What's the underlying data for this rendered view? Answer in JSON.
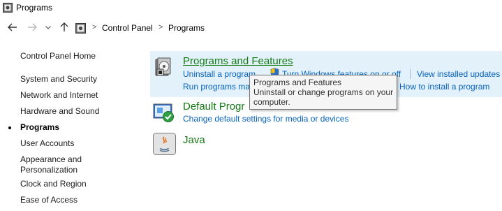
{
  "window": {
    "title": "Programs"
  },
  "breadcrumb": {
    "items": [
      "Control Panel",
      "Programs"
    ],
    "separator": ">"
  },
  "sidebar": {
    "home": "Control Panel Home",
    "items": [
      "System and Security",
      "Network and Internet",
      "Hardware and Sound",
      "Programs",
      "User Accounts",
      "Appearance and Personalization",
      "Clock and Region",
      "Ease of Access"
    ],
    "current": "Programs",
    "appearance_line1": "Appearance and",
    "appearance_line2": "Personalization"
  },
  "categories": {
    "programs_features": {
      "title": "Programs and Features",
      "links": [
        "Uninstall a program",
        "Turn Windows features on or off",
        "View installed updates"
      ],
      "run_older": "Run programs ma",
      "how_to_install": "How to install a program"
    },
    "default_programs": {
      "title": "Default Progr",
      "link": "Change default settings for media or devices"
    },
    "java": {
      "title": "Java"
    }
  },
  "tooltip": {
    "line1": "Programs and Features",
    "line2": "Uninstall or change programs on your",
    "line3": "computer."
  },
  "colors": {
    "highlight": "#e3f1fb",
    "category_title": "#147a14",
    "link": "#0563c1"
  },
  "icons": {
    "back": "arrow-left-icon",
    "forward": "arrow-right-icon",
    "recent": "chevron-down-icon",
    "up": "arrow-up-icon",
    "control_panel": "control-panel-icon",
    "programs_features": "programs-disk-icon",
    "shield": "uac-shield-icon",
    "default_programs": "default-programs-icon",
    "java": "java-icon"
  }
}
